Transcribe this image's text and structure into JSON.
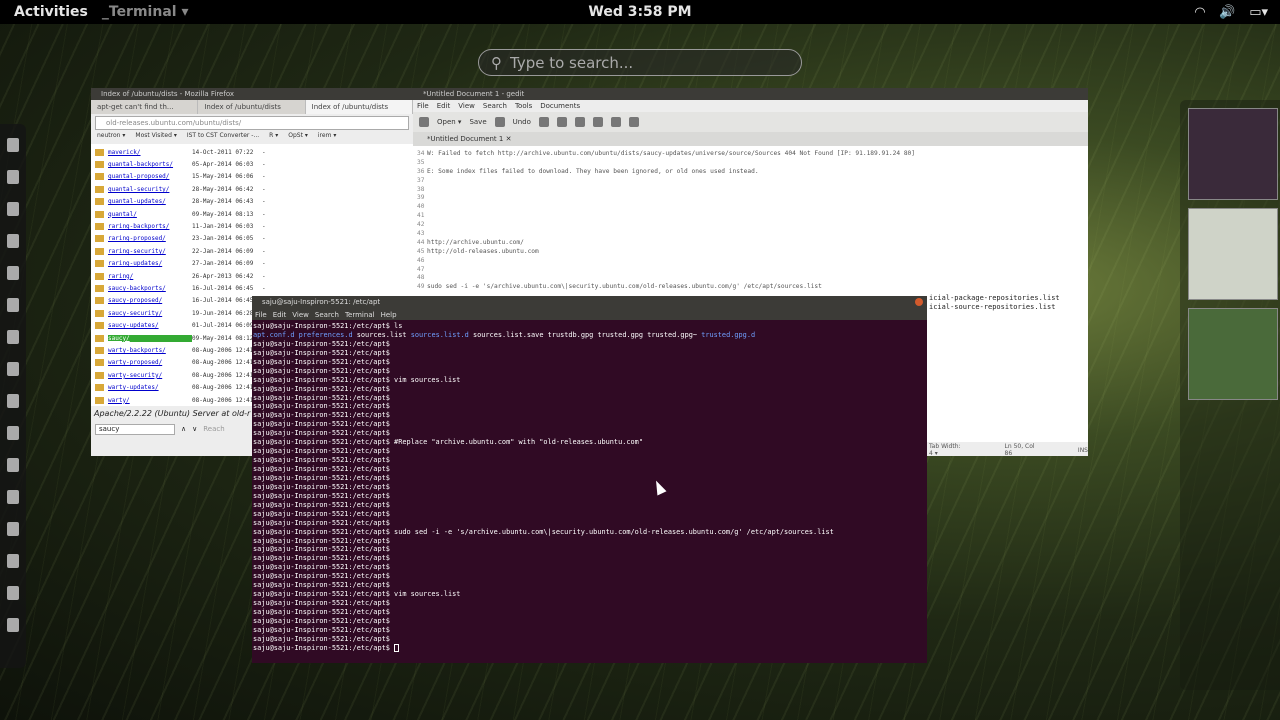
{
  "topbar": {
    "activities": "Activities",
    "app_menu": "_Terminal ▾",
    "clock": "Wed   3:58 PM",
    "wifi": "wifi",
    "volume": "🔊",
    "battery": "▭▾"
  },
  "search": {
    "placeholder": "Type to search..."
  },
  "firefox": {
    "title": "Index of /ubuntu/dists - Mozilla Firefox",
    "tabs": [
      "apt-get can't find th...",
      "Index of /ubuntu/dists",
      "Index of /ubuntu/dists"
    ],
    "url": "old-releases.ubuntu.com/ubuntu/dists/",
    "bookmarks": [
      "neutron ▾",
      "Most Visited ▾",
      "IST to CST Converter -...",
      "R ▾",
      "OpSt ▾",
      "irem ▾"
    ],
    "rows": [
      {
        "name": "maverick/",
        "date": "14-Oct-2011 07:22",
        "size": "-"
      },
      {
        "name": "quantal-backports/",
        "date": "05-Apr-2014 06:03",
        "size": "-"
      },
      {
        "name": "quantal-proposed/",
        "date": "15-May-2014 06:06",
        "size": "-"
      },
      {
        "name": "quantal-security/",
        "date": "28-May-2014 06:42",
        "size": "-"
      },
      {
        "name": "quantal-updates/",
        "date": "28-May-2014 06:43",
        "size": "-"
      },
      {
        "name": "quantal/",
        "date": "09-May-2014 08:13",
        "size": "-"
      },
      {
        "name": "raring-backports/",
        "date": "11-Jan-2014 06:03",
        "size": "-"
      },
      {
        "name": "raring-proposed/",
        "date": "23-Jan-2014 06:05",
        "size": "-"
      },
      {
        "name": "raring-security/",
        "date": "22-Jan-2014 06:09",
        "size": "-"
      },
      {
        "name": "raring-updates/",
        "date": "27-Jan-2014 06:09",
        "size": "-"
      },
      {
        "name": "raring/",
        "date": "26-Apr-2013 06:42",
        "size": "-"
      },
      {
        "name": "saucy-backports/",
        "date": "16-Jul-2014 06:45",
        "size": "-"
      },
      {
        "name": "saucy-proposed/",
        "date": "16-Jul-2014 06:45",
        "size": "-"
      },
      {
        "name": "saucy-security/",
        "date": "19-Jun-2014 06:28",
        "size": "-"
      },
      {
        "name": "saucy-updates/",
        "date": "01-Jul-2014 06:09",
        "size": "-"
      },
      {
        "name": "saucy/",
        "date": "09-May-2014 08:12",
        "size": "-"
      },
      {
        "name": "warty-backports/",
        "date": "08-Aug-2006 12:41",
        "size": "-"
      },
      {
        "name": "warty-proposed/",
        "date": "08-Aug-2006 12:41",
        "size": "-"
      },
      {
        "name": "warty-security/",
        "date": "08-Aug-2006 12:41",
        "size": "-"
      },
      {
        "name": "warty-updates/",
        "date": "08-Aug-2006 12:41",
        "size": "-"
      },
      {
        "name": "warty/",
        "date": "08-Aug-2006 12:41",
        "size": "-"
      }
    ],
    "highlighted_row": "saucy/",
    "footer": "Apache/2.2.22 (Ubuntu) Server at old-r",
    "find_value": "saucy",
    "find_label": "Reach"
  },
  "gedit": {
    "title": "*Untitled Document 1 - gedit",
    "menu": [
      "File",
      "Edit",
      "View",
      "Search",
      "Tools",
      "Documents"
    ],
    "toolbar": [
      "Open ▾",
      "Save",
      "Undo"
    ],
    "tab": "*Untitled Document 1",
    "lines": [
      {
        "n": "34",
        "t": "W: Failed to fetch http://archive.ubuntu.com/ubuntu/dists/saucy-updates/universe/source/Sources  404  Not Found [IP: 91.189.91.24 80]"
      },
      {
        "n": "35",
        "t": ""
      },
      {
        "n": "36",
        "t": "E: Some index files failed to download. They have been ignored, or old ones used instead."
      },
      {
        "n": "37",
        "t": ""
      },
      {
        "n": "38",
        "t": ""
      },
      {
        "n": "39",
        "t": ""
      },
      {
        "n": "40",
        "t": ""
      },
      {
        "n": "41",
        "t": ""
      },
      {
        "n": "42",
        "t": ""
      },
      {
        "n": "43",
        "t": ""
      },
      {
        "n": "44",
        "t": "http://archive.ubuntu.com/"
      },
      {
        "n": "45",
        "t": "http://old-releases.ubuntu.com"
      },
      {
        "n": "46",
        "t": ""
      },
      {
        "n": "47",
        "t": ""
      },
      {
        "n": "48",
        "t": ""
      },
      {
        "n": "49",
        "t": "sudo sed -i -e 's/archive.ubuntu.com\\|security.ubuntu.com/old-releases.ubuntu.com/g' /etc/apt/sources.list"
      }
    ],
    "right_lines": [
      "icial-package-repositories.list",
      "icial-source-repositories.list"
    ],
    "status": [
      "Tab Width: 4 ▾",
      "Ln 50, Col 86",
      "INS"
    ]
  },
  "terminal": {
    "title": "saju@saju-Inspiron-5521: /etc/apt",
    "menu": [
      "File",
      "Edit",
      "View",
      "Search",
      "Terminal",
      "Help"
    ],
    "prompt": "saju@saju-Inspiron-5521:/etc/apt$",
    "lines": [
      {
        "p": true,
        "cmd": " ls"
      },
      {
        "p": false,
        "ls": true
      },
      {
        "p": true,
        "cmd": ""
      },
      {
        "p": true,
        "cmd": ""
      },
      {
        "p": true,
        "cmd": ""
      },
      {
        "p": true,
        "cmd": ""
      },
      {
        "p": true,
        "cmd": " vim sources.list"
      },
      {
        "p": true,
        "cmd": ""
      },
      {
        "p": true,
        "cmd": ""
      },
      {
        "p": true,
        "cmd": ""
      },
      {
        "p": true,
        "cmd": ""
      },
      {
        "p": true,
        "cmd": ""
      },
      {
        "p": true,
        "cmd": ""
      },
      {
        "p": true,
        "cmd": " #Replace \"archive.ubuntu.com\" with \"old-releases.ubuntu.com\""
      },
      {
        "p": true,
        "cmd": ""
      },
      {
        "p": true,
        "cmd": ""
      },
      {
        "p": true,
        "cmd": ""
      },
      {
        "p": true,
        "cmd": ""
      },
      {
        "p": true,
        "cmd": ""
      },
      {
        "p": true,
        "cmd": ""
      },
      {
        "p": true,
        "cmd": ""
      },
      {
        "p": true,
        "cmd": ""
      },
      {
        "p": true,
        "cmd": ""
      },
      {
        "p": true,
        "cmd": " sudo sed -i -e 's/archive.ubuntu.com\\|security.ubuntu.com/old-releases.ubuntu.com/g' /etc/apt/sources.list"
      },
      {
        "p": true,
        "cmd": ""
      },
      {
        "p": true,
        "cmd": ""
      },
      {
        "p": true,
        "cmd": ""
      },
      {
        "p": true,
        "cmd": ""
      },
      {
        "p": true,
        "cmd": ""
      },
      {
        "p": true,
        "cmd": ""
      },
      {
        "p": true,
        "cmd": " vim sources.list"
      },
      {
        "p": true,
        "cmd": ""
      },
      {
        "p": true,
        "cmd": ""
      },
      {
        "p": true,
        "cmd": ""
      },
      {
        "p": true,
        "cmd": ""
      },
      {
        "p": true,
        "cmd": ""
      },
      {
        "p": true,
        "cmd": "",
        "cursor": true
      }
    ],
    "ls_items": [
      {
        "t": "apt.conf.d",
        "c": "blue"
      },
      {
        "t": "preferences.d",
        "c": "blue"
      },
      {
        "t": "sources.list",
        "c": "white"
      },
      {
        "t": "sources.list.d",
        "c": "blue"
      },
      {
        "t": "sources.list.save",
        "c": "white"
      },
      {
        "t": "trustdb.gpg",
        "c": "white"
      },
      {
        "t": "trusted.gpg",
        "c": "white"
      },
      {
        "t": "trusted.gpg~",
        "c": "white"
      },
      {
        "t": "trusted.gpg.d",
        "c": "blue"
      }
    ]
  },
  "colors": {
    "terminal_bg": "#300a24",
    "topbar_bg": "#000000",
    "dir_blue": "#6f9fff"
  }
}
